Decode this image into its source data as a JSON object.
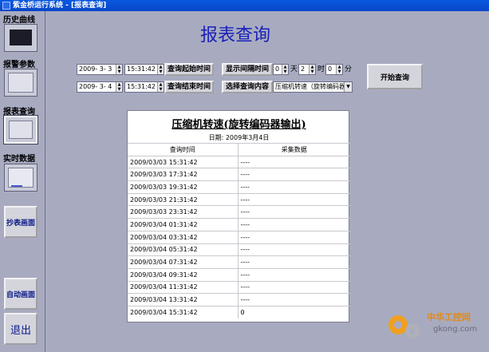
{
  "window": {
    "title": "紫金桥运行系统 - [报表查询]"
  },
  "sidebar": {
    "items": [
      {
        "label": "历史曲线"
      },
      {
        "label": "报警参数"
      },
      {
        "label": "报表查询"
      },
      {
        "label": "实时数据"
      }
    ],
    "buttons": {
      "copy_table": "抄表画面",
      "auto_screen": "自动画面",
      "exit": "退出"
    }
  },
  "page": {
    "title": "报表查询"
  },
  "query": {
    "start_date": "2009- 3- 3",
    "start_time": "15:31:42",
    "start_btn": "查询起始时间",
    "end_date": "2009- 3- 4",
    "end_time": "15:31:42",
    "end_btn": "查询结束时间",
    "interval_btn": "显示间隔时间",
    "interval_days": "0",
    "unit_day": "天",
    "interval_hours": "2",
    "unit_hour": "时",
    "interval_minutes": "0",
    "unit_minute": "分",
    "content_btn": "选择查询内容",
    "content_value": "压缩机转速（旋转编码器",
    "run_btn": "开始查询"
  },
  "report": {
    "title": "压缩机转速(旋转编码器输出)",
    "date_label": "日期:",
    "date_value": "2009年3月4日",
    "columns": [
      "查询时间",
      "采集数据"
    ],
    "rows": [
      [
        "2009/03/03 15:31:42",
        "----"
      ],
      [
        "2009/03/03 17:31:42",
        "----"
      ],
      [
        "2009/03/03 19:31:42",
        "----"
      ],
      [
        "2009/03/03 21:31:42",
        "----"
      ],
      [
        "2009/03/03 23:31:42",
        "----"
      ],
      [
        "2009/03/04 01:31:42",
        "----"
      ],
      [
        "2009/03/04 03:31:42",
        "----"
      ],
      [
        "2009/03/04 05:31:42",
        "----"
      ],
      [
        "2009/03/04 07:31:42",
        "----"
      ],
      [
        "2009/03/04 09:31:42",
        "----"
      ],
      [
        "2009/03/04 11:31:42",
        "----"
      ],
      [
        "2009/03/04 13:31:42",
        "----"
      ],
      [
        "2009/03/04 15:31:42",
        "0"
      ]
    ]
  },
  "watermark": {
    "text": "中华工控网",
    "url": "gkong.com"
  }
}
